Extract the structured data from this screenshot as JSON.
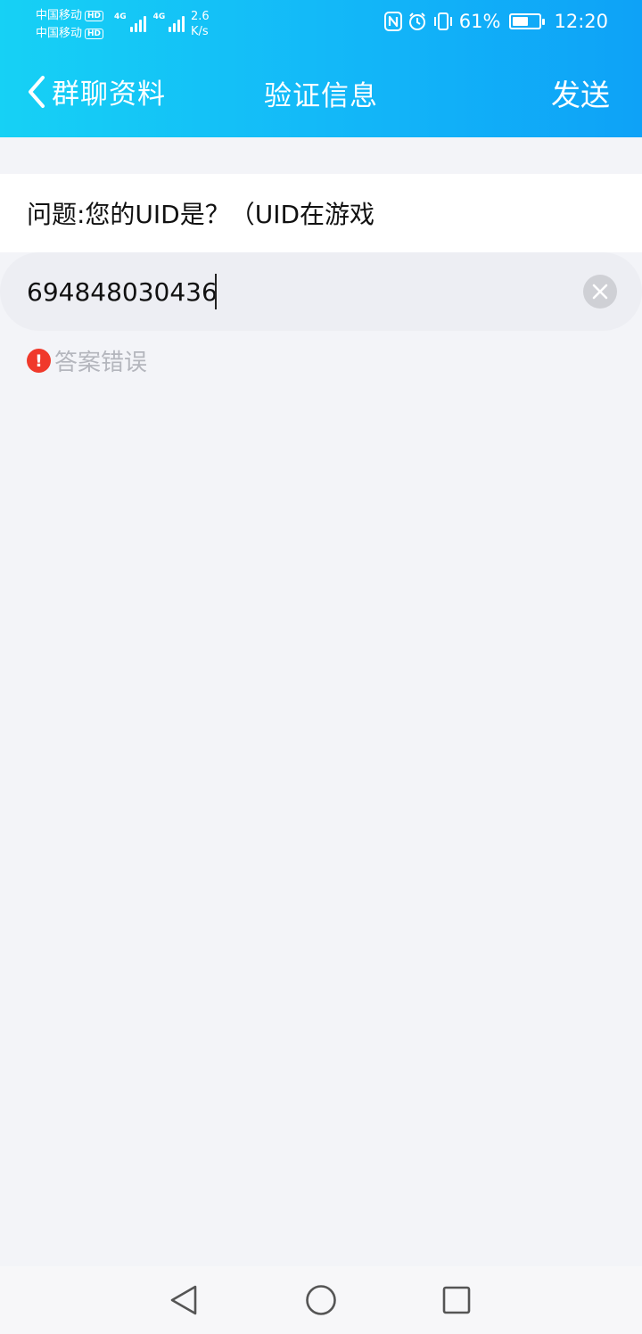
{
  "status_bar": {
    "carrier_1": "中国移动",
    "carrier_2": "中国移动",
    "hd_badge": "HD",
    "network_tag": "4G",
    "net_speed_value": "2.6",
    "net_speed_unit": "K/s",
    "battery_percent": "61%",
    "battery_level": 0.61,
    "time": "12:20",
    "icons": [
      "nfc-icon",
      "alarm-icon",
      "vibrate-icon",
      "battery-icon"
    ]
  },
  "nav": {
    "back_label": "群聊资料",
    "title": "验证信息",
    "send_label": "发送"
  },
  "question": {
    "text": "问题:您的UID是？（UID在游戏"
  },
  "answer": {
    "value": "694848030436"
  },
  "error": {
    "icon_glyph": "!",
    "text": "答案错误"
  },
  "colors": {
    "header_gradient_start": "#16d1f5",
    "header_gradient_end": "#0ea2f7",
    "error_red": "#f0392b",
    "hint_gray": "#b4b6bd"
  }
}
